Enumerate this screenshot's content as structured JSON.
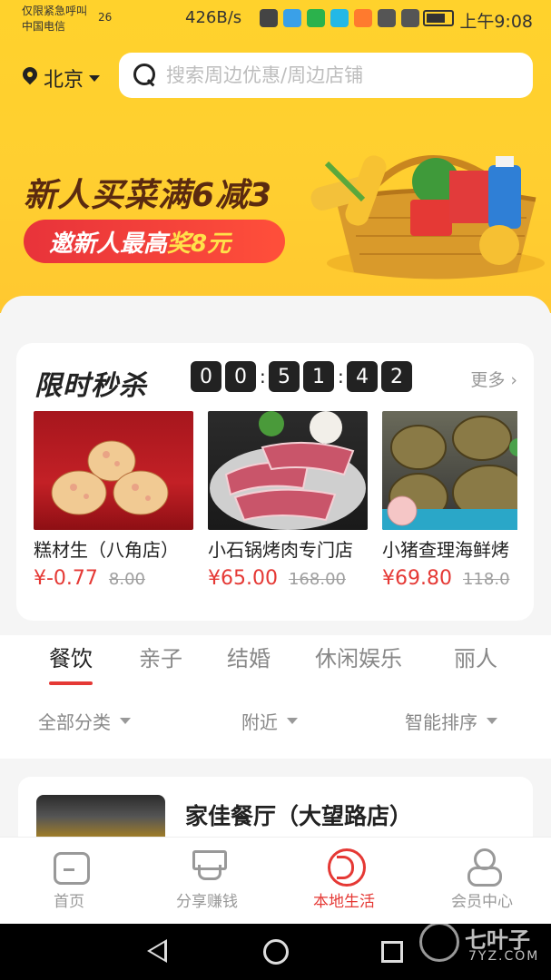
{
  "status_bar": {
    "carrier_line1": "仅限紧急呼叫",
    "carrier_line2": "中国电信",
    "network": "26",
    "speed": "426B/s",
    "time": "上午9:08"
  },
  "header": {
    "city": "北京",
    "search_placeholder": "搜索周边优惠/周边店铺"
  },
  "banner": {
    "title": "新人买菜满6减3",
    "invite_prefix": "邀新人最高",
    "invite_highlight": "奖8元"
  },
  "flash_sale": {
    "title": "限时秒杀",
    "countdown": [
      "0",
      "0",
      "5",
      "1",
      "4",
      "2"
    ],
    "more_label": "更多",
    "items": [
      {
        "name": "糕材生（八角店）",
        "price": "¥-0.77",
        "original_price": "8.00"
      },
      {
        "name": "小石锅烤肉专门店",
        "price": "¥65.00",
        "original_price": "168.00"
      },
      {
        "name": "小猪查理海鲜烤",
        "price": "¥69.80",
        "original_price": "118.0"
      }
    ]
  },
  "category_tabs": [
    "餐饮",
    "亲子",
    "结婚",
    "休闲娱乐",
    "丽人"
  ],
  "active_tab": "餐饮",
  "filters": [
    "全部分类",
    "附近",
    "智能排序"
  ],
  "shop_list": [
    {
      "name": "家佳餐厅（大望路店）"
    }
  ],
  "bottom_nav": {
    "items": [
      "首页",
      "分享赚钱",
      "本地生活",
      "会员中心"
    ],
    "active": "本地生活"
  },
  "watermark": {
    "text": "七叶子",
    "sub": "7YZ.COM"
  },
  "colors": {
    "accent": "#e53935",
    "brand_yellow": "#ffd22c",
    "dark": "#222222"
  }
}
